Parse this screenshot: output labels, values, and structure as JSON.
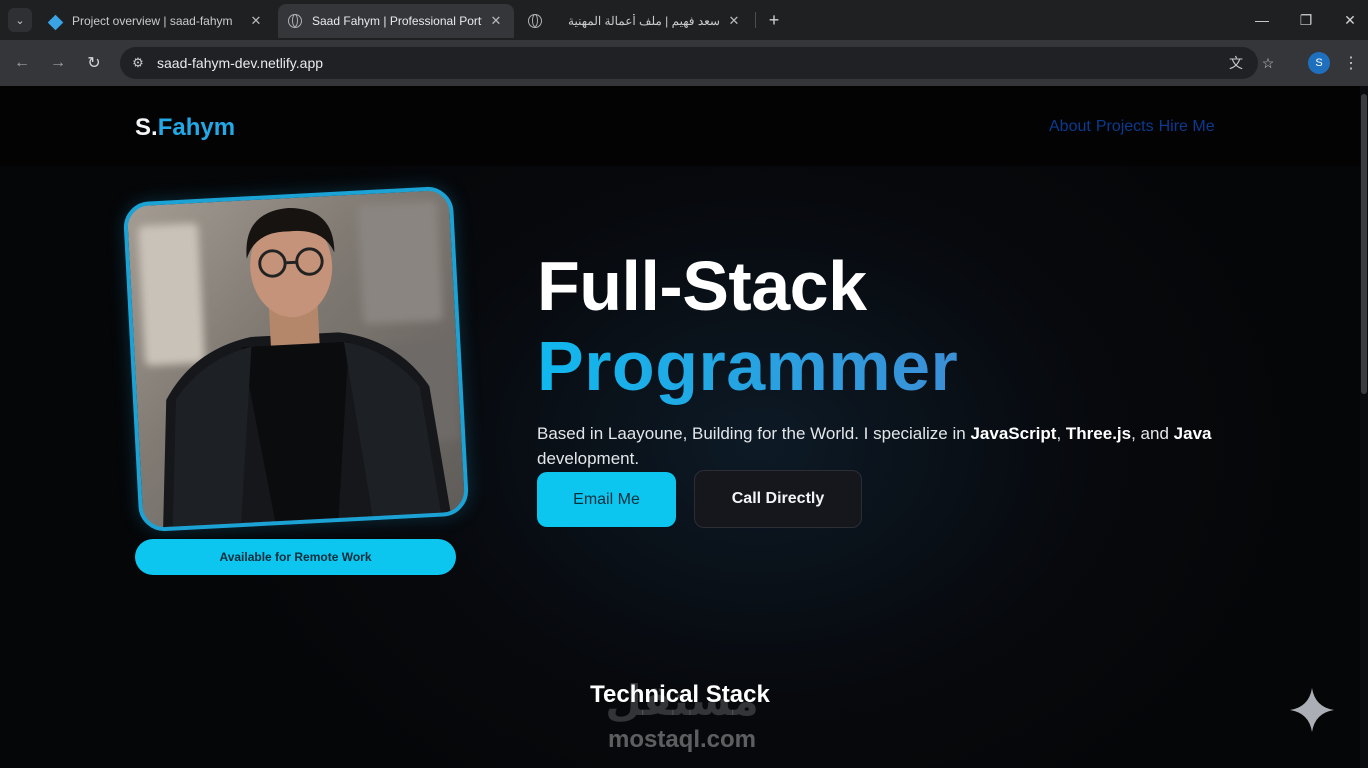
{
  "browser": {
    "tabs": [
      {
        "title": "Project overview | saad-fahym",
        "favicon": "netlify-diamond-icon",
        "active": false
      },
      {
        "title": "Saad Fahym | Professional Portfolio",
        "favicon": "globe-icon",
        "active": true
      },
      {
        "title": "سعد فهيم | ملف أعمالة المهنية",
        "favicon": "globe-icon",
        "active": false
      }
    ],
    "url": "saad-fahym-dev.netlify.app",
    "profile_initial": "S",
    "icons": {
      "tab_menu": "chevron-down-icon",
      "close": "close-icon",
      "new_tab": "plus-icon",
      "back": "arrow-left-icon",
      "forward": "arrow-right-icon",
      "reload": "reload-icon",
      "site_info": "tune-icon",
      "translate": "translate-icon",
      "bookmark": "star-icon",
      "menu": "kebab-icon",
      "minimize": "minimize-icon",
      "restore": "restore-icon",
      "window_close": "close-icon"
    },
    "glyphs": {
      "tab_menu": "⌄",
      "close": "✕",
      "new_tab": "+",
      "back": "←",
      "forward": "→",
      "reload": "↻",
      "site_info": "⚙",
      "translate": "文",
      "bookmark": "☆",
      "menu": "⋮",
      "minimize": "—",
      "restore": "❐"
    }
  },
  "site": {
    "logo_prefix": "S.",
    "logo_accent": "Fahym",
    "nav": [
      "About",
      "Projects",
      "Hire Me"
    ],
    "badge": "Available for Remote Work",
    "hero_title": "Full-Stack",
    "hero_subtitle": "Programmer",
    "description": {
      "part1": "Based in Laayoune, Building for the World. I specialize in ",
      "skill1": "JavaScript",
      "sep1": ", ",
      "skill2": "Three.js",
      "sep2": ", and ",
      "skill3": "Java",
      "part2": " development."
    },
    "buttons": {
      "email": "Email Me",
      "call": "Call Directly"
    },
    "section_title": "Technical Stack"
  },
  "watermark": {
    "arabic": "مستقل",
    "latin": "mostaql.com"
  },
  "colors": {
    "accent": "#0cc6ef",
    "logo_accent": "#22a9e6",
    "nav_link": "#0b3a8f",
    "background": "#050608"
  }
}
